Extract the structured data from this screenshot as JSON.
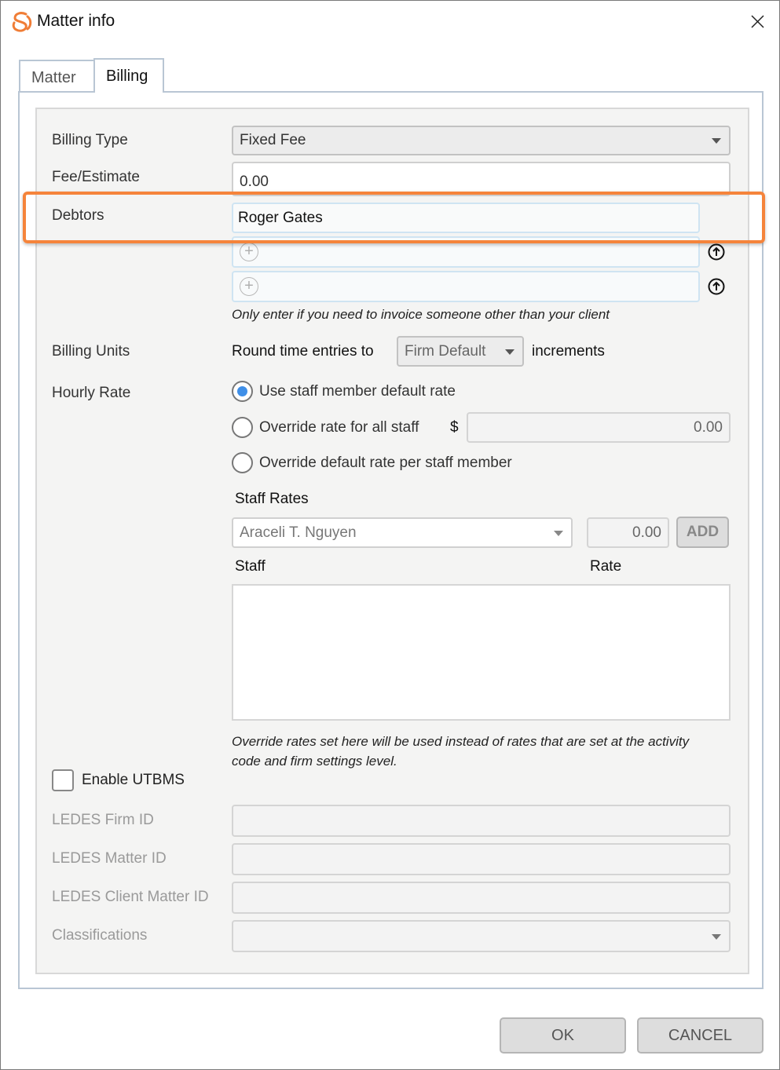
{
  "window": {
    "title": "Matter info",
    "icons": {
      "app": "app-logo-icon",
      "close": "close-icon"
    }
  },
  "tabs": [
    {
      "label": "Matter",
      "active": false
    },
    {
      "label": "Billing",
      "active": true
    }
  ],
  "billing": {
    "billing_type": {
      "label": "Billing Type",
      "value": "Fixed Fee"
    },
    "fee_estimate": {
      "label": "Fee/Estimate",
      "value": "0.00"
    },
    "debtors": {
      "label": "Debtors",
      "entries": [
        "Roger Gates",
        "",
        ""
      ],
      "hint": "Only enter if you need to invoice someone other than your client"
    },
    "billing_units": {
      "label": "Billing Units",
      "prefix": "Round time entries to",
      "value": "Firm Default",
      "suffix": "increments"
    },
    "hourly_rate": {
      "label": "Hourly Rate",
      "options": [
        {
          "label": "Use staff member default rate",
          "selected": true
        },
        {
          "label": "Override rate for all staff",
          "selected": false
        },
        {
          "label": "Override default rate per staff member",
          "selected": false
        }
      ],
      "currency_symbol": "$",
      "override_all_value": "0.00"
    },
    "staff_rates": {
      "title": "Staff Rates",
      "staff_selected": "Araceli T. Nguyen",
      "rate_value": "0.00",
      "add_label": "ADD",
      "columns": [
        "Staff",
        "Rate"
      ],
      "rows": [],
      "hint": "Override rates set here will be used instead of rates that are set at the activity code and firm settings level."
    },
    "utbms": {
      "label": "Enable UTBMS",
      "checked": false
    },
    "ledes_firm_id": {
      "label": "LEDES Firm ID",
      "value": ""
    },
    "ledes_matter_id": {
      "label": "LEDES Matter ID",
      "value": ""
    },
    "ledes_client_matter_id": {
      "label": "LEDES Client Matter ID",
      "value": ""
    },
    "classifications": {
      "label": "Classifications",
      "value": ""
    }
  },
  "footer": {
    "ok_label": "OK",
    "cancel_label": "CANCEL"
  },
  "colors": {
    "highlight": "#f5843b",
    "radio_selected": "#3f8fe8",
    "logo": "#f07d36"
  }
}
